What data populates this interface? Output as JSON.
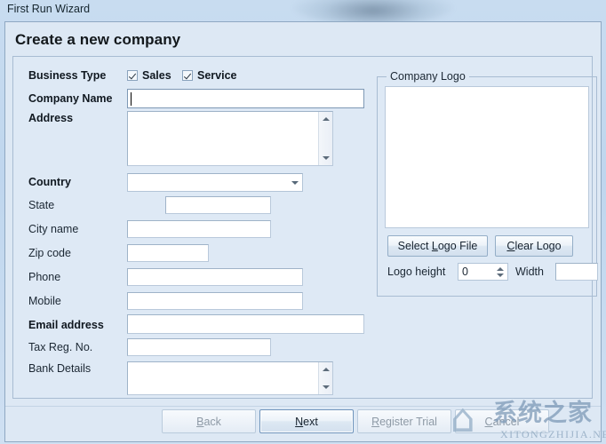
{
  "window": {
    "title": "First Run Wizard"
  },
  "page": {
    "title": "Create a new company"
  },
  "form": {
    "business_type": {
      "label": "Business Type",
      "options": [
        {
          "label": "Sales",
          "checked": true
        },
        {
          "label": "Service",
          "checked": true
        }
      ]
    },
    "fields": [
      {
        "key": "company_name",
        "label": "Company Name",
        "value": "",
        "bold": true
      },
      {
        "key": "address",
        "label": "Address",
        "value": "",
        "bold": true
      },
      {
        "key": "country",
        "label": "Country",
        "value": "",
        "bold": true
      },
      {
        "key": "state",
        "label": "State",
        "value": "",
        "bold": false
      },
      {
        "key": "city_name",
        "label": "City name",
        "value": "",
        "bold": false
      },
      {
        "key": "zip_code",
        "label": "Zip code",
        "value": "",
        "bold": false
      },
      {
        "key": "phone",
        "label": "Phone",
        "value": "",
        "bold": false
      },
      {
        "key": "mobile",
        "label": "Mobile",
        "value": "",
        "bold": false
      },
      {
        "key": "email_address",
        "label": "Email address",
        "value": "",
        "bold": true
      },
      {
        "key": "tax_reg_no",
        "label": "Tax Reg. No.",
        "value": "",
        "bold": false
      },
      {
        "key": "bank_details",
        "label": "Bank Details",
        "value": "",
        "bold": false
      }
    ]
  },
  "logo_panel": {
    "title": "Company Logo",
    "select_button": "Select Logo File",
    "select_button_mnemonic": "L",
    "clear_button": "Clear Logo",
    "clear_button_mnemonic": "C",
    "height_label": "Logo height",
    "height_value": "0",
    "width_label": "Width",
    "width_value": ""
  },
  "footer": {
    "back": "Back",
    "back_mnemonic": "B",
    "next": "Next",
    "next_mnemonic": "N",
    "register_trial": "Register Trial",
    "register_trial_mnemonic": "R",
    "cancel": "Cancel",
    "cancel_mnemonic": "C"
  },
  "watermark": {
    "glyph": "⌂",
    "chinese": "系统之家",
    "domain": "XITONGZHIJIA.NET"
  }
}
